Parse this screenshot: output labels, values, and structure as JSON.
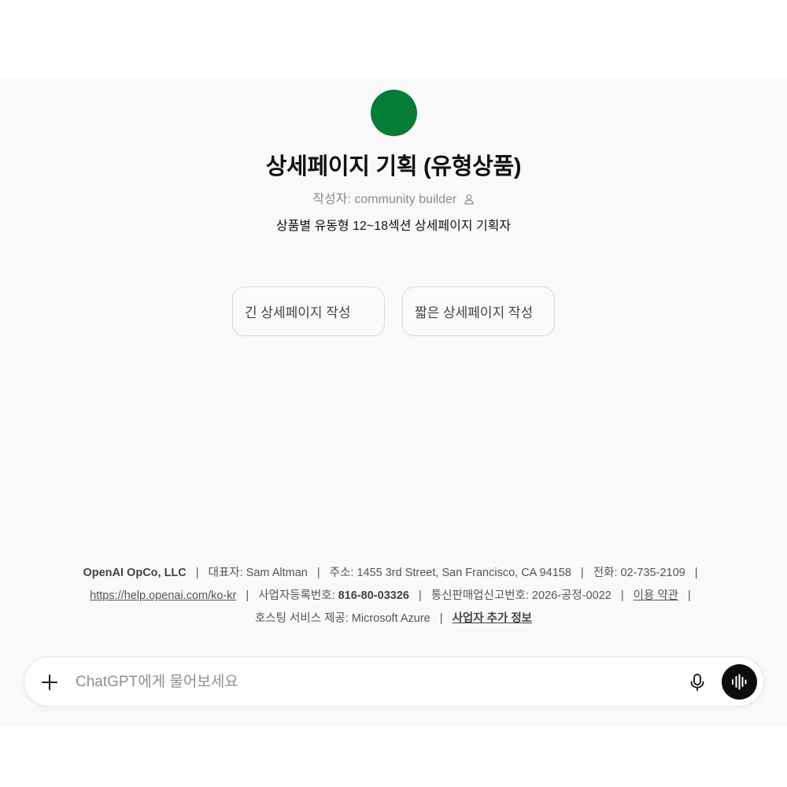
{
  "gpt": {
    "title": "상세페이지 기획 (유형상품)",
    "author_prefix": "작성자:",
    "author_name": "community builder",
    "description": "상품별 유동형 12~18섹션 상세페이지 기획자",
    "icon_color": "#067d37"
  },
  "starters": [
    {
      "label": "긴 상세페이지 작성"
    },
    {
      "label": "짧은 상세페이지 작성"
    }
  ],
  "footer": {
    "company": "OpenAI OpCo, LLC",
    "ceo": "대표자: Sam Altman",
    "address": "주소: 1455 3rd Street, San Francisco, CA 94158",
    "phone": "전화: 02-735-2109",
    "help_url": "https://help.openai.com/ko-kr",
    "biz_reg_label": "사업자등록번호:",
    "biz_reg_number": "816-80-03326",
    "mail_order": "통신판매업신고번호: 2026-공정-0022",
    "terms": "이용 약관",
    "hosting": "호스팅 서비스 제공: Microsoft Azure",
    "more_info": "사업자 추가 정보",
    "separator": "|"
  },
  "composer": {
    "placeholder": "ChatGPT에게 물어보세요",
    "plus_icon": "plus-icon",
    "mic_icon": "microphone-icon",
    "voice_icon": "voice-waveform-icon"
  }
}
